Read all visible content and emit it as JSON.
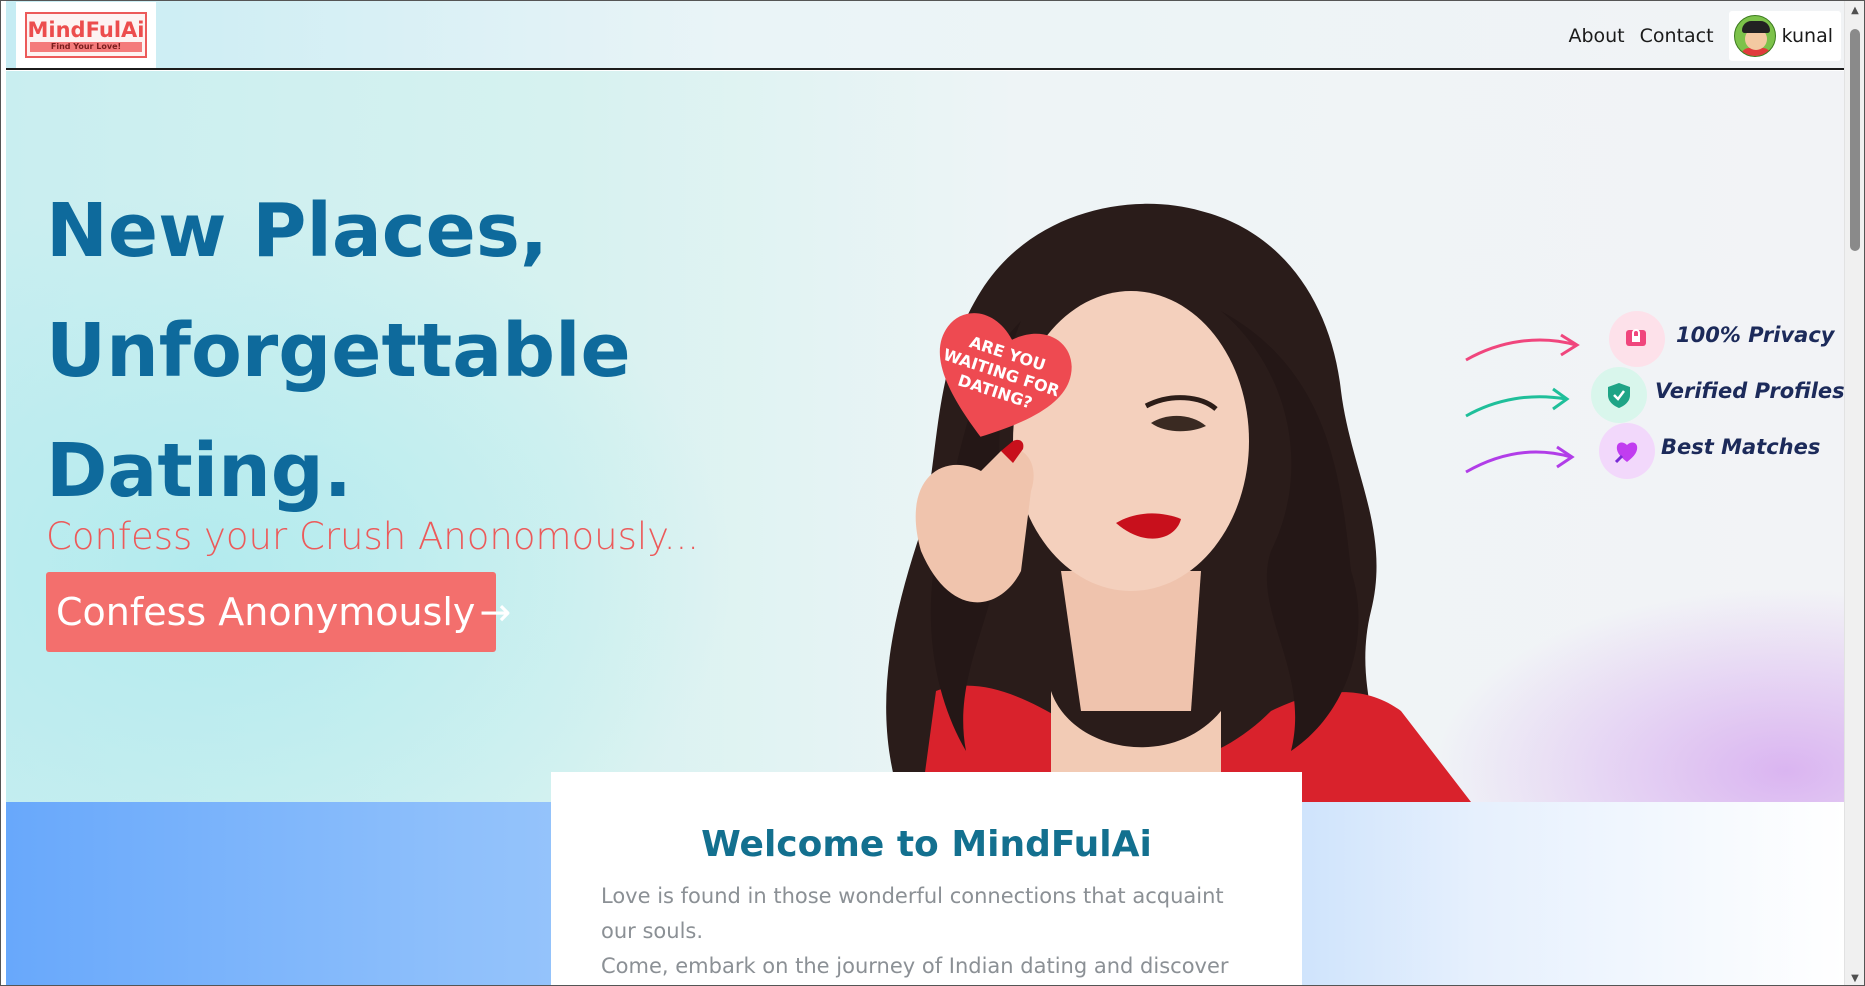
{
  "navbar": {
    "logo_name": "MindFulAi",
    "logo_tagline": "Find Your Love!",
    "links": [
      "About",
      "Contact"
    ],
    "user_name": "kunal"
  },
  "hero": {
    "title_lines": [
      "New Places,",
      "Unforgettable",
      "Dating."
    ],
    "subtitle": "Confess your Crush Anonomously...",
    "cta_label": "Confess Anonymously",
    "cta_icon": "arrow-right-icon",
    "heart_card_text": [
      "ARE YOU",
      "WAITING FOR",
      "DATING?"
    ]
  },
  "features": [
    {
      "label": "100% Privacy",
      "icon": "lock-chat-icon",
      "color": "#f0467d"
    },
    {
      "label": "Verified Profiles",
      "icon": "shield-check-icon",
      "color": "#1fbf9a"
    },
    {
      "label": "Best Matches",
      "icon": "heart-rocket-icon",
      "color": "#b13de8"
    }
  ],
  "welcome": {
    "title": "Welcome to MindFulAi",
    "paragraph_1": "Love is found in those wonderful connections that acquaint our souls.",
    "paragraph_2": "Come, embark on the journey of Indian dating and discover your"
  },
  "colors": {
    "brand_blue": "#0e6a9c",
    "brand_coral": "#f36f6d",
    "welcome_title": "#13708f"
  }
}
